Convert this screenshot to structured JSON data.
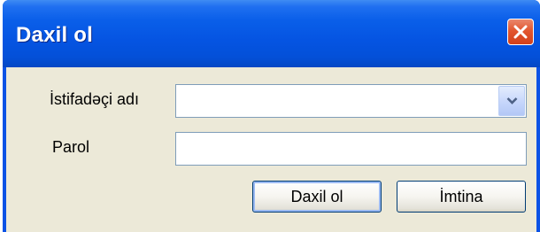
{
  "dialog": {
    "title": "Daxil ol",
    "close_icon": "close-x-icon"
  },
  "form": {
    "username_label": "İstifadəçi adı",
    "username_value": "",
    "username_dropdown_icon": "chevron-down-icon",
    "password_label": "Parol",
    "password_value": ""
  },
  "buttons": {
    "login_label": "Daxil ol",
    "cancel_label": "İmtina"
  },
  "colors": {
    "titlebar": "#0554e2",
    "client": "#ece9d8",
    "close_button": "#e2562f",
    "field_border": "#7f9db9",
    "button_border": "#003c74"
  }
}
